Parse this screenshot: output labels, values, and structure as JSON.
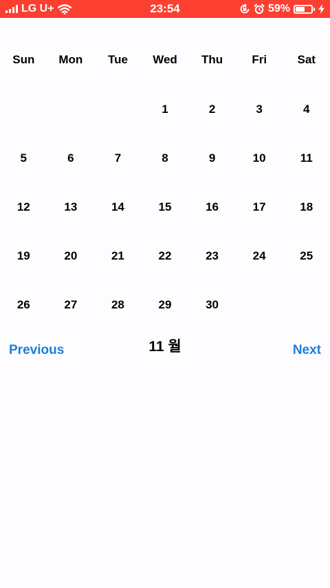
{
  "status_bar": {
    "carrier": "LG U+",
    "time": "23:54",
    "battery_percent": "59%",
    "battery_level": 0.59,
    "background_color": "#fb3f30",
    "icons": [
      "signal-icon",
      "wifi-icon",
      "rotation-lock-icon",
      "alarm-icon",
      "battery-icon",
      "charging-icon"
    ]
  },
  "calendar": {
    "weekdays": [
      "Sun",
      "Mon",
      "Tue",
      "Wed",
      "Thu",
      "Fri",
      "Sat"
    ],
    "days": [
      "",
      "",
      "",
      "1",
      "2",
      "3",
      "4",
      "5",
      "6",
      "7",
      "8",
      "9",
      "10",
      "11",
      "12",
      "13",
      "14",
      "15",
      "16",
      "17",
      "18",
      "19",
      "20",
      "21",
      "22",
      "23",
      "24",
      "25",
      "26",
      "27",
      "28",
      "29",
      "30",
      "",
      ""
    ],
    "month_label": "11 월",
    "previous_label": "Previous",
    "next_label": "Next",
    "accent_color": "#1a7fdc"
  }
}
